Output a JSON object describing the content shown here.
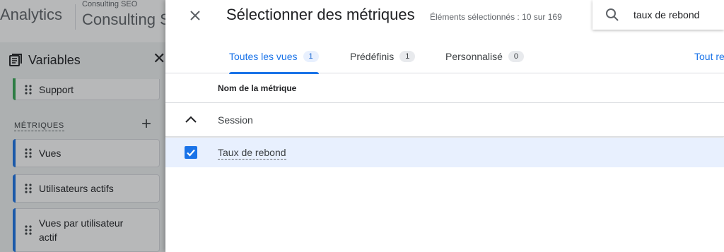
{
  "background": {
    "app_name": "Analytics",
    "account_name": "Consulting SEO",
    "property_name": "Consulting S",
    "variables_title": "Variables",
    "support_label": "Support",
    "metrics_section": "MÉTRIQUES",
    "metrics": [
      "Vues",
      "Utilisateurs actifs",
      "Vues par utilisateur actif"
    ]
  },
  "dialog": {
    "title": "Sélectionner des métriques",
    "count_text": "Éléments sélectionnés : 10 sur 169",
    "search_value": "taux de rebond",
    "tabs": [
      {
        "label": "Toutes les vues",
        "count": "1"
      },
      {
        "label": "Prédéfinis",
        "count": "1"
      },
      {
        "label": "Personnalisé",
        "count": "0"
      }
    ],
    "tab_link": "Tout re",
    "column_header": "Nom de la métrique",
    "group_label": "Session",
    "rows": [
      {
        "label": "Taux de rebond",
        "checked": true
      }
    ]
  },
  "colors": {
    "accent": "#1a73e8",
    "selected_row": "#e8f0fe",
    "dimension_chip_bar": "#34a853"
  }
}
